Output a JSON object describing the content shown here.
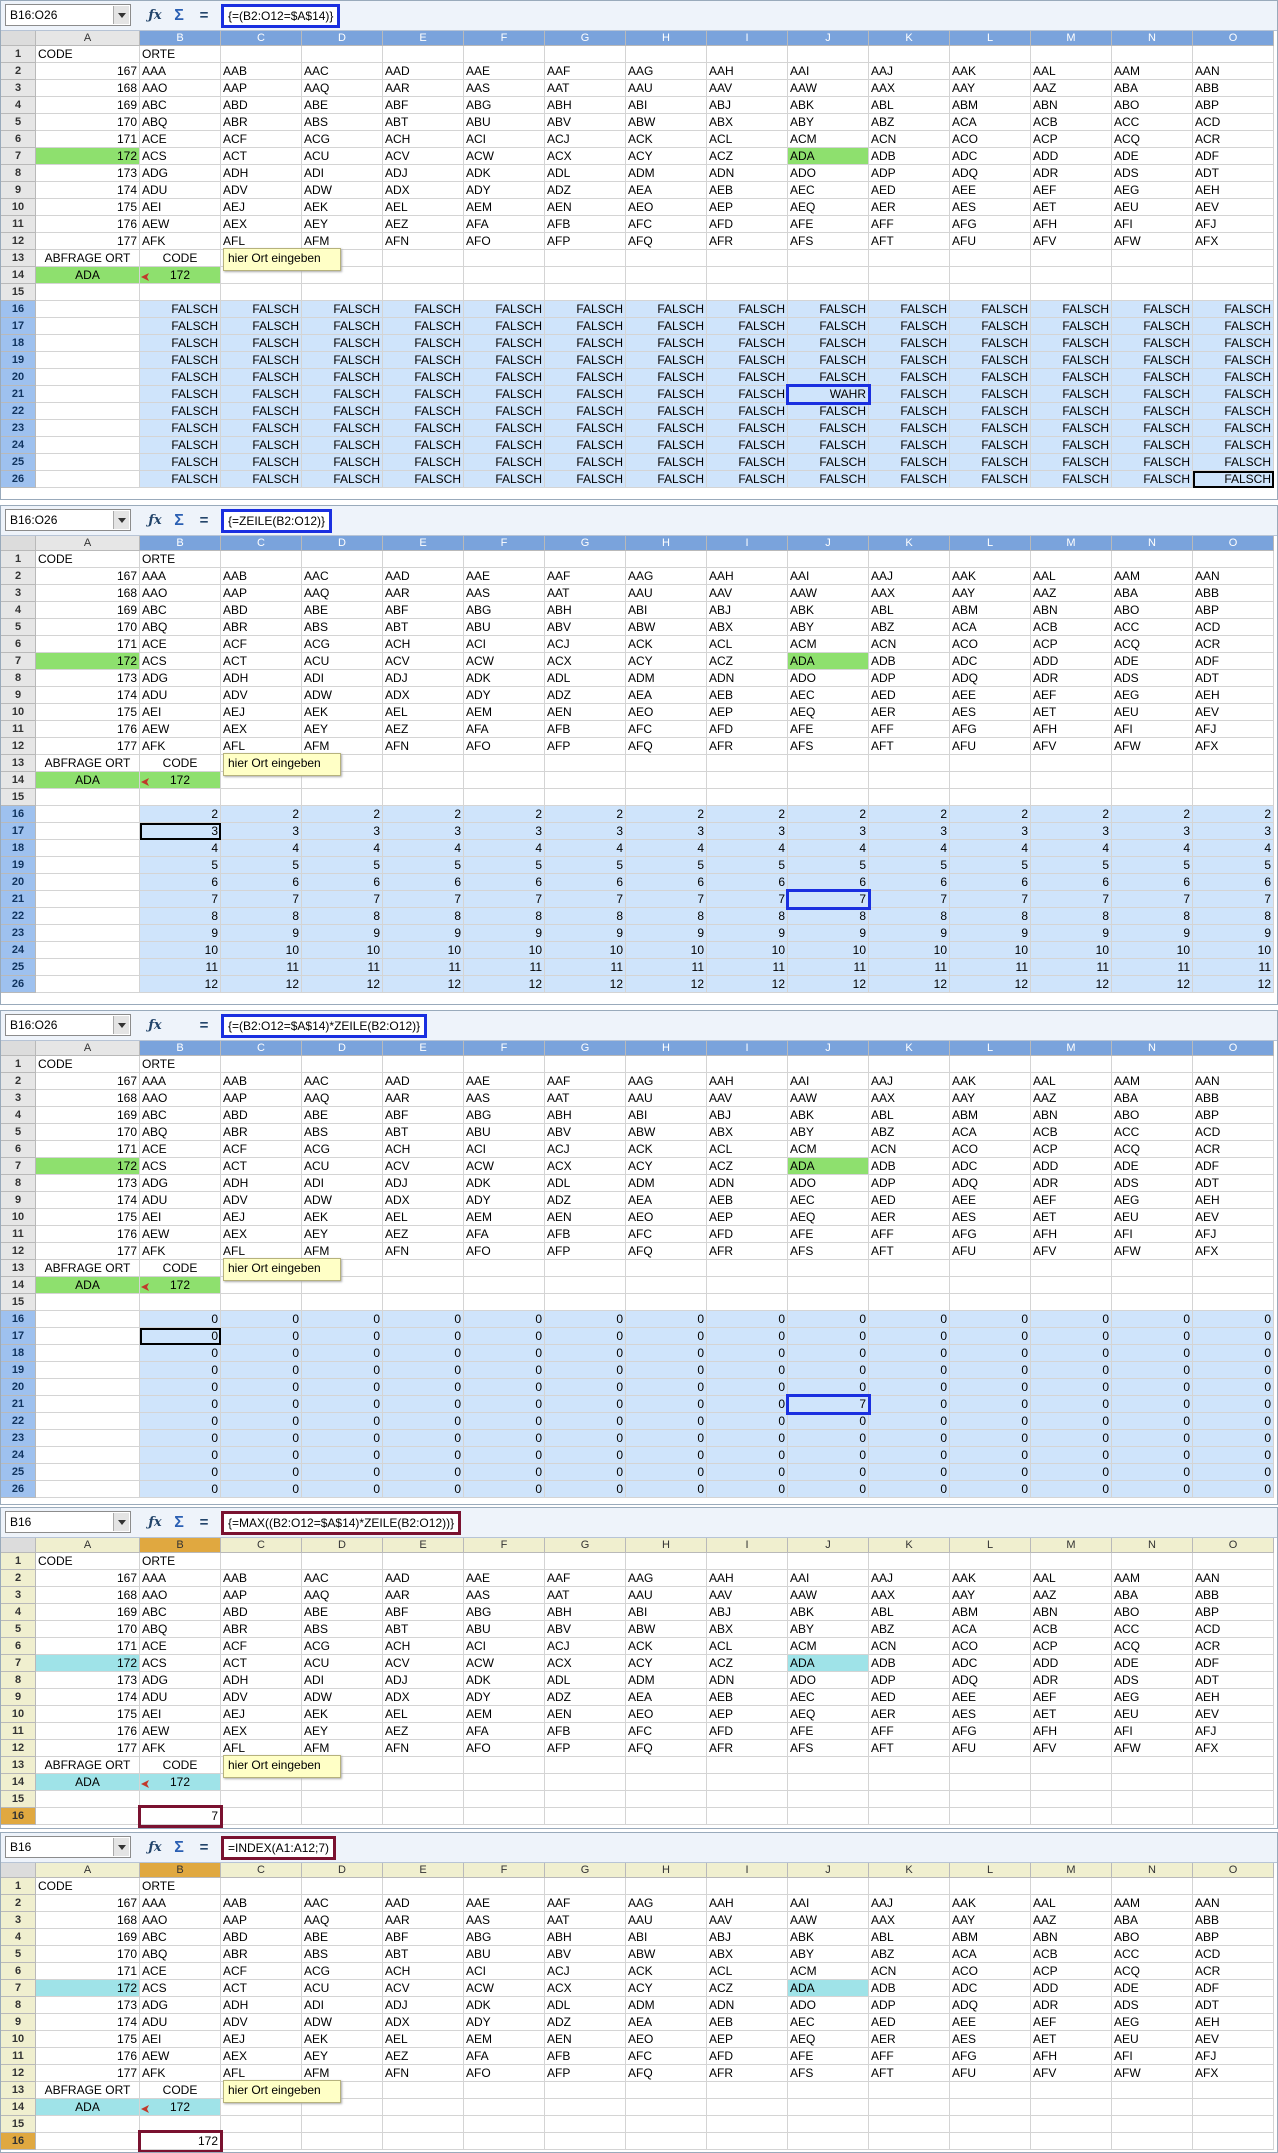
{
  "columns": [
    "A",
    "B",
    "C",
    "D",
    "E",
    "F",
    "G",
    "H",
    "I",
    "J",
    "K",
    "L",
    "M",
    "N",
    "O"
  ],
  "rows": [
    "1",
    "2",
    "3",
    "4",
    "5",
    "6",
    "7",
    "8",
    "9",
    "10",
    "11",
    "12",
    "13",
    "14",
    "15",
    "16",
    "17",
    "18",
    "19",
    "20",
    "21",
    "22",
    "23",
    "24",
    "25",
    "26"
  ],
  "sheet": {
    "a1": "CODE",
    "b1": "ORTE",
    "codes": [
      "167",
      "168",
      "169",
      "170",
      "171",
      "172",
      "173",
      "174",
      "175",
      "176",
      "177"
    ],
    "places": [
      [
        "AAA",
        "AAB",
        "AAC",
        "AAD",
        "AAE",
        "AAF",
        "AAG",
        "AAH",
        "AAI",
        "AAJ",
        "AAK",
        "AAL",
        "AAM",
        "AAN"
      ],
      [
        "AAO",
        "AAP",
        "AAQ",
        "AAR",
        "AAS",
        "AAT",
        "AAU",
        "AAV",
        "AAW",
        "AAX",
        "AAY",
        "AAZ",
        "ABA",
        "ABB"
      ],
      [
        "ABC",
        "ABD",
        "ABE",
        "ABF",
        "ABG",
        "ABH",
        "ABI",
        "ABJ",
        "ABK",
        "ABL",
        "ABM",
        "ABN",
        "ABO",
        "ABP"
      ],
      [
        "ABQ",
        "ABR",
        "ABS",
        "ABT",
        "ABU",
        "ABV",
        "ABW",
        "ABX",
        "ABY",
        "ABZ",
        "ACA",
        "ACB",
        "ACC",
        "ACD"
      ],
      [
        "ACE",
        "ACF",
        "ACG",
        "ACH",
        "ACI",
        "ACJ",
        "ACK",
        "ACL",
        "ACM",
        "ACN",
        "ACO",
        "ACP",
        "ACQ",
        "ACR"
      ],
      [
        "ACS",
        "ACT",
        "ACU",
        "ACV",
        "ACW",
        "ACX",
        "ACY",
        "ACZ",
        "ADA",
        "ADB",
        "ADC",
        "ADD",
        "ADE",
        "ADF"
      ],
      [
        "ADG",
        "ADH",
        "ADI",
        "ADJ",
        "ADK",
        "ADL",
        "ADM",
        "ADN",
        "ADO",
        "ADP",
        "ADQ",
        "ADR",
        "ADS",
        "ADT"
      ],
      [
        "ADU",
        "ADV",
        "ADW",
        "ADX",
        "ADY",
        "ADZ",
        "AEA",
        "AEB",
        "AEC",
        "AED",
        "AEE",
        "AEF",
        "AEG",
        "AEH"
      ],
      [
        "AEI",
        "AEJ",
        "AEK",
        "AEL",
        "AEM",
        "AEN",
        "AEO",
        "AEP",
        "AEQ",
        "AER",
        "AES",
        "AET",
        "AEU",
        "AEV"
      ],
      [
        "AEW",
        "AEX",
        "AEY",
        "AEZ",
        "AFA",
        "AFB",
        "AFC",
        "AFD",
        "AFE",
        "AFF",
        "AFG",
        "AFH",
        "AFI",
        "AFJ"
      ],
      [
        "AFK",
        "AFL",
        "AFM",
        "AFN",
        "AFO",
        "AFP",
        "AFQ",
        "AFR",
        "AFS",
        "AFT",
        "AFU",
        "AFV",
        "AFW",
        "AFX"
      ]
    ],
    "a13": "ABFRAGE ORT",
    "b13": "CODE",
    "a14": "ADA",
    "b14": "172",
    "comment": "hier Ort eingeben"
  },
  "panels": [
    {
      "name_box": "B16:O26",
      "formula": "{=(B2:O12=$A$14)}",
      "show_sum": true,
      "result_type": "bool",
      "false_text": "FALSCH",
      "true_text": "WAHR"
    },
    {
      "name_box": "B16:O26",
      "formula": "{=ZEILE(B2:O12)}",
      "show_sum": true,
      "result_type": "rownum",
      "values": [
        "2",
        "3",
        "4",
        "5",
        "6",
        "7",
        "8",
        "9",
        "10",
        "11",
        "12"
      ]
    },
    {
      "name_box": "B16:O26",
      "formula": "{=(B2:O12=$A$14)*ZEILE(B2:O12)}",
      "show_sum": false,
      "result_type": "product",
      "zero": "0",
      "hit": "7"
    },
    {
      "name_box": "B16",
      "formula": "{=MAX((B2:O12=$A$14)*ZEILE(B2:O12))}",
      "show_sum": true,
      "result_type": "single",
      "result": "7"
    },
    {
      "name_box": "B16",
      "formula": "=INDEX(A1:A12;7)",
      "show_sum": true,
      "result_type": "single",
      "result": "172"
    }
  ]
}
